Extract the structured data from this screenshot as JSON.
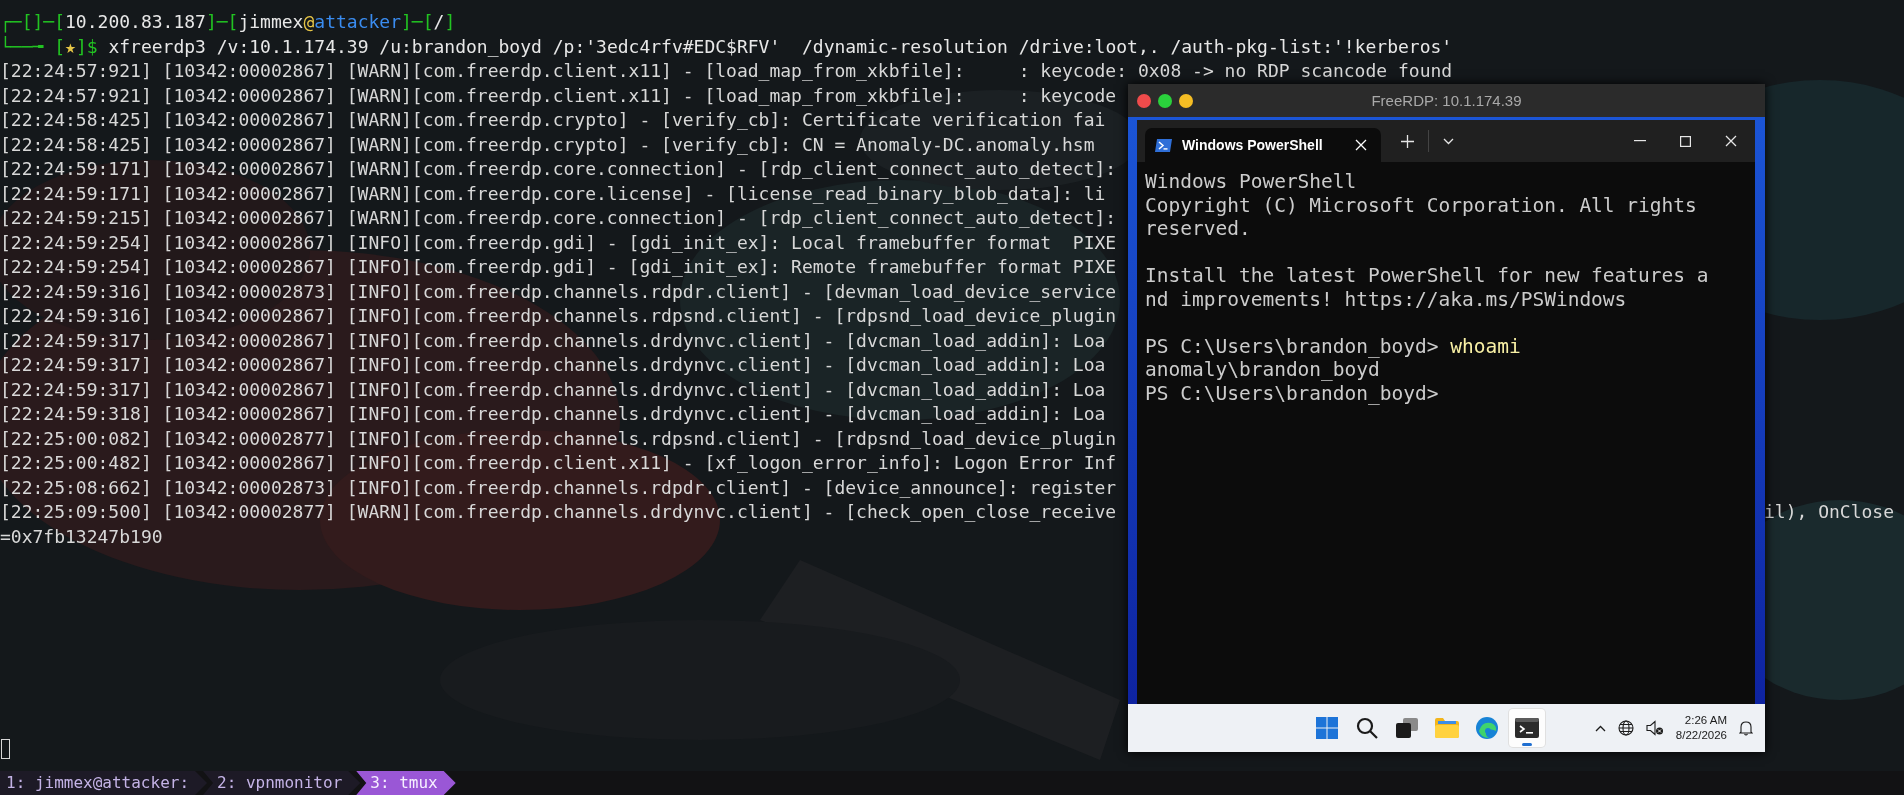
{
  "terminal": {
    "prompt_lines": [
      [
        {
          "text": "┌─[]─[",
          "color": "#22c322"
        },
        {
          "text": "10.200.83.187",
          "color": "#e8e8e8"
        },
        {
          "text": "]─[",
          "color": "#22c322"
        },
        {
          "text": "jimmex",
          "color": "#e8e8e8"
        },
        {
          "text": "@",
          "color": "#e6c547"
        },
        {
          "text": "attacker",
          "color": "#3a8cf0"
        },
        {
          "text": "]─[",
          "color": "#22c322"
        },
        {
          "text": "/",
          "color": "#e8e8e8"
        },
        {
          "text": "]",
          "color": "#22c322"
        }
      ],
      [
        {
          "text": "└──╼ [",
          "color": "#22c322"
        },
        {
          "text": "★",
          "color": "#e6c547"
        },
        {
          "text": "]$ ",
          "color": "#22c322"
        },
        {
          "text": "xfreerdp3 /v:10.1.174.39 /u:brandon_boyd /p:'3edc4rfv#EDC$RFV'  /dynamic-resolution /drive:loot,. /auth-pkg-list:'!kerberos'",
          "color": "#e8e8e8"
        }
      ]
    ],
    "log_lines": [
      {
        "text": "[22:24:57:921] [10342:00002867] [WARN][com.freerdp.client.x11] - [load_map_from_xkbfile]:     : keycode: 0x08 -> no RDP scancode found"
      },
      {
        "text": "[22:24:57:921] [10342:00002867] [WARN][com.freerdp.client.x11] - [load_map_from_xkbfile]:     : keycode"
      },
      {
        "text": "[22:24:58:425] [10342:00002867] [WARN][com.freerdp.crypto] - [verify_cb]: Certificate verification fai"
      },
      {
        "text": "[22:24:58:425] [10342:00002867] [WARN][com.freerdp.crypto] - [verify_cb]: CN = Anomaly-DC.anomaly.hsm"
      },
      {
        "text": "[22:24:59:171] [10342:00002867] [WARN][com.freerdp.core.connection] - [rdp_client_connect_auto_detect]:"
      },
      {
        "text": "[22:24:59:171] [10342:00002867] [WARN][com.freerdp.core.license] - [license_read_binary_blob_data]: li"
      },
      {
        "text": "[22:24:59:215] [10342:00002867] [WARN][com.freerdp.core.connection] - [rdp_client_connect_auto_detect]:"
      },
      {
        "text": "[22:24:59:254] [10342:00002867] [INFO][com.freerdp.gdi] - [gdi_init_ex]: Local framebuffer format  PIXE"
      },
      {
        "text": "[22:24:59:254] [10342:00002867] [INFO][com.freerdp.gdi] - [gdi_init_ex]: Remote framebuffer format PIXE"
      },
      {
        "text": "[22:24:59:316] [10342:00002873] [INFO][com.freerdp.channels.rdpdr.client] - [devman_load_device_service"
      },
      {
        "text": "[22:24:59:316] [10342:00002867] [INFO][com.freerdp.channels.rdpsnd.client] - [rdpsnd_load_device_plugin"
      },
      {
        "text": "[22:24:59:317] [10342:00002867] [INFO][com.freerdp.channels.drdynvc.client] - [dvcman_load_addin]: Loa"
      },
      {
        "text": "[22:24:59:317] [10342:00002867] [INFO][com.freerdp.channels.drdynvc.client] - [dvcman_load_addin]: Loa"
      },
      {
        "text": "[22:24:59:317] [10342:00002867] [INFO][com.freerdp.channels.drdynvc.client] - [dvcman_load_addin]: Loa"
      },
      {
        "text": "[22:24:59:318] [10342:00002867] [INFO][com.freerdp.channels.drdynvc.client] - [dvcman_load_addin]: Loa"
      },
      {
        "text": "[22:25:00:082] [10342:00002877] [INFO][com.freerdp.channels.rdpsnd.client] - [rdpsnd_load_device_plugin"
      },
      {
        "text": "[22:25:00:482] [10342:00002867] [INFO][com.freerdp.client.x11] - [xf_logon_error_info]: Logon Error Inf"
      },
      {
        "text": "[22:25:08:662] [10342:00002873] [INFO][com.freerdp.channels.rdpdr.client] - [device_announce]: register"
      },
      {
        "text": "[22:25:09:500] [10342:00002877] [WARN][com.freerdp.channels.drdynvc.client] - [check_open_close_receive",
        "right": "il), OnClose"
      },
      {
        "text": "=0x7fb13247b190"
      }
    ]
  },
  "tmux_tabs": [
    {
      "label": "1: jimmex@attacker:",
      "selected": false
    },
    {
      "label": "2: vpnmonitor",
      "selected": false
    },
    {
      "label": "3: tmux",
      "selected": true
    }
  ],
  "rdp_window": {
    "title": "FreeRDP: 10.1.174.39",
    "tab": "Windows PowerShell",
    "lines": [
      {
        "kind": "output",
        "text": "Windows PowerShell"
      },
      {
        "kind": "output",
        "text": "Copyright (C) Microsoft Corporation. All rights"
      },
      {
        "kind": "output",
        "text": "reserved."
      },
      {
        "kind": "blank"
      },
      {
        "kind": "output",
        "text": "Install the latest PowerShell for new features a"
      },
      {
        "kind": "output",
        "text": "nd improvements! https://aka.ms/PSWindows"
      },
      {
        "kind": "blank"
      },
      {
        "kind": "prompt",
        "text": "PS C:\\Users\\brandon_boyd> ",
        "command": "whoami"
      },
      {
        "kind": "output",
        "text": "anomaly\\brandon_boyd"
      },
      {
        "kind": "prompt",
        "text": "PS C:\\Users\\brandon_boyd>"
      }
    ],
    "taskbar": {
      "apps": [
        {
          "kind": "start",
          "selected": false
        },
        {
          "kind": "search",
          "selected": false
        },
        {
          "kind": "taskview",
          "selected": false
        },
        {
          "kind": "explorer",
          "selected": false
        },
        {
          "kind": "browser",
          "selected": false
        },
        {
          "kind": "terminal",
          "selected": true
        }
      ],
      "time": "2:26 AM",
      "date": "8/22/2026"
    }
  }
}
